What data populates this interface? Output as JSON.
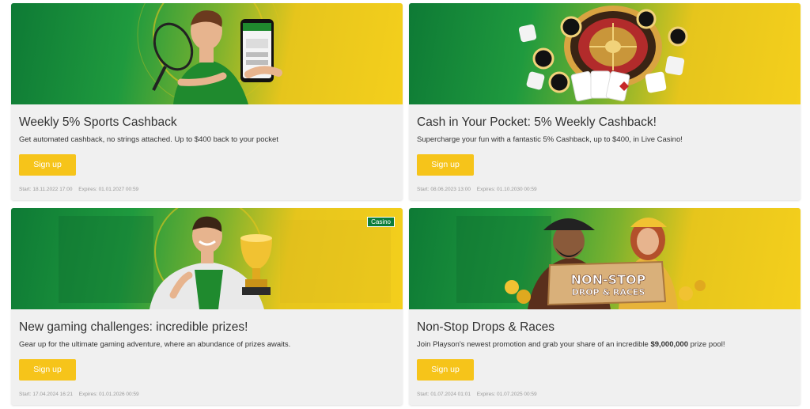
{
  "colors": {
    "brand_green": "#0e7a35",
    "brand_yellow": "#f4cf1c",
    "button": "#f6c41a"
  },
  "promos": [
    {
      "title": "Weekly 5% Sports Cashback",
      "description": "Get automated cashback, no strings attached. Up to $400 back to your pocket",
      "button_label": "Sign up",
      "start": "Start: 18.11.2022 17:00",
      "expires": "Expires: 01.01.2027 00:59",
      "image": "man-with-phone-and-racket"
    },
    {
      "title": "Cash in Your Pocket: 5% Weekly Cashback!",
      "description": "Supercharge your fun with a fantastic 5% Cashback, up to $400, in Live Casino!",
      "button_label": "Sign up",
      "start": "Start: 08.06.2023 13:00",
      "expires": "Expires: 01.10.2030 00:59",
      "image": "roulette-chips-dice-cards"
    },
    {
      "title": "New gaming challenges: incredible prizes!",
      "description": "Gear up for the ultimate gaming adventure, where an abundance of prizes awaits.",
      "button_label": "Sign up",
      "start": "Start: 17.04.2024 16:21",
      "expires": "Expires: 01.01.2026 00:59",
      "tag": "Casino",
      "image": "man-with-trophy"
    },
    {
      "title": "Non-Stop Drops & Races",
      "description_pre": "Join Playson's newest promotion and grab your share of an incredible ",
      "description_bold": "$9,000,000",
      "description_post": " prize pool!",
      "button_label": "Sign up",
      "start": "Start: 01.07.2024 01:01",
      "expires": "Expires: 01.07.2025 00:59",
      "banner_text_1": "NON-STOP",
      "banner_text_2": "DROP & RACES",
      "image": "pirate-and-cleopatra"
    }
  ]
}
